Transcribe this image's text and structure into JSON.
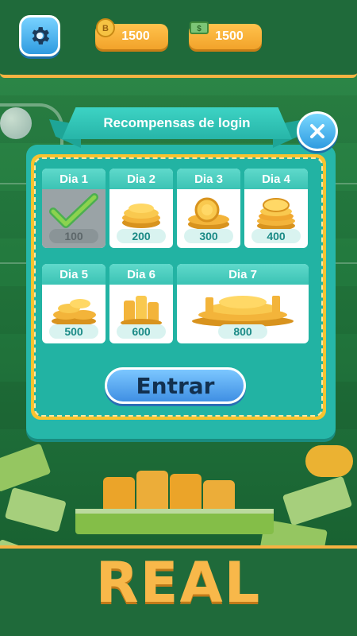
{
  "header": {
    "coins_balance": "1500",
    "cash_balance": "1500",
    "coin_icon_text": "B",
    "cash_icon_text": "$"
  },
  "rewards_modal": {
    "title": "Recompensas de login",
    "days": [
      {
        "label": "Dia 1",
        "amount": "100",
        "claimed": true
      },
      {
        "label": "Dia 2",
        "amount": "200",
        "claimed": false
      },
      {
        "label": "Dia 3",
        "amount": "300",
        "claimed": false
      },
      {
        "label": "Dia 4",
        "amount": "400",
        "claimed": false
      },
      {
        "label": "Dia 5",
        "amount": "500",
        "claimed": false
      },
      {
        "label": "Dia 6",
        "amount": "600",
        "claimed": false
      },
      {
        "label": "Dia 7",
        "amount": "800",
        "claimed": false
      }
    ],
    "enter_label": "Entrar"
  },
  "footer": {
    "banner_text": "REAL"
  },
  "colors": {
    "accent_gold": "#f5b342",
    "panel_teal": "#26b7a9",
    "button_blue": "#3f8fe3"
  }
}
